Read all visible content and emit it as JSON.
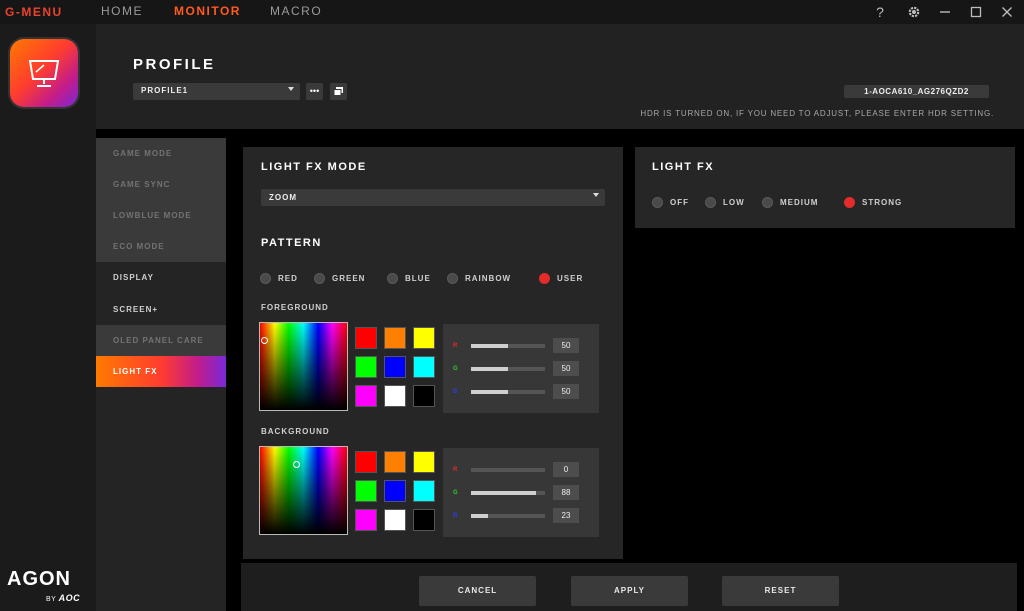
{
  "titlebar": {
    "brand": "G-MENU",
    "nav": [
      {
        "label": "HOME",
        "active": false
      },
      {
        "label": "MONITOR",
        "active": true
      },
      {
        "label": "MACRO",
        "active": false
      }
    ],
    "help": "?"
  },
  "branding": {
    "agon": "AGON",
    "by": "BY",
    "aoc": "AOC"
  },
  "header": {
    "title": "PROFILE",
    "profile_value": "PROFILE1",
    "more_label": "•••",
    "monitor_id": "1-AOCA610_AG276QZD2",
    "hdr_note": "HDR IS TURNED ON, IF YOU NEED TO ADJUST, PLEASE ENTER HDR SETTING."
  },
  "sidebar": {
    "items": [
      {
        "label": "GAME MODE",
        "state": "disabled"
      },
      {
        "label": "GAME SYNC",
        "state": "disabled"
      },
      {
        "label": "LOWBLUE MODE",
        "state": "disabled"
      },
      {
        "label": "ECO MODE",
        "state": "disabled"
      },
      {
        "label": "DISPLAY",
        "state": "enabled"
      },
      {
        "label": "SCREEN+",
        "state": "enabled"
      },
      {
        "label": "OLED PANEL CARE",
        "state": "disabled"
      },
      {
        "label": "LIGHT FX",
        "state": "active"
      }
    ]
  },
  "lightfx_mode": {
    "title": "LIGHT FX MODE",
    "mode_value": "ZOOM",
    "pattern_title": "PATTERN",
    "patterns": [
      {
        "label": "RED",
        "selected": false
      },
      {
        "label": "GREEN",
        "selected": false
      },
      {
        "label": "BLUE",
        "selected": false
      },
      {
        "label": "RAINBOW",
        "selected": false
      },
      {
        "label": "USER",
        "selected": true
      }
    ],
    "foreground": {
      "label": "FOREGROUND",
      "rgb": [
        {
          "channel": "R",
          "value": "50",
          "level": 50,
          "color": "#e52b2b"
        },
        {
          "channel": "G",
          "value": "50",
          "level": 50,
          "color": "#2ad12a"
        },
        {
          "channel": "B",
          "value": "50",
          "level": 50,
          "color": "#2b3ce5"
        }
      ]
    },
    "background": {
      "label": "BACKGROUND",
      "rgb": [
        {
          "channel": "R",
          "value": "0",
          "level": 0,
          "color": "#e52b2b"
        },
        {
          "channel": "G",
          "value": "88",
          "level": 88,
          "color": "#2ad12a"
        },
        {
          "channel": "B",
          "value": "23",
          "level": 23,
          "color": "#2b3ce5"
        }
      ]
    },
    "swatches": [
      "#ff0000",
      "#ff7f00",
      "#ffff00",
      "#00ff00",
      "#0000ff",
      "#00ffff",
      "#ff00ff",
      "#ffffff",
      "#000000"
    ]
  },
  "lightfx": {
    "title": "LIGHT FX",
    "levels": [
      {
        "label": "OFF",
        "selected": false
      },
      {
        "label": "LOW",
        "selected": false
      },
      {
        "label": "MEDIUM",
        "selected": false
      },
      {
        "label": "STRONG",
        "selected": true
      }
    ]
  },
  "footer": {
    "cancel": "CANCEL",
    "apply": "APPLY",
    "reset": "RESET"
  },
  "colors": {
    "accent": "#e52b2b",
    "brand_orange": "#ff5a1f"
  }
}
